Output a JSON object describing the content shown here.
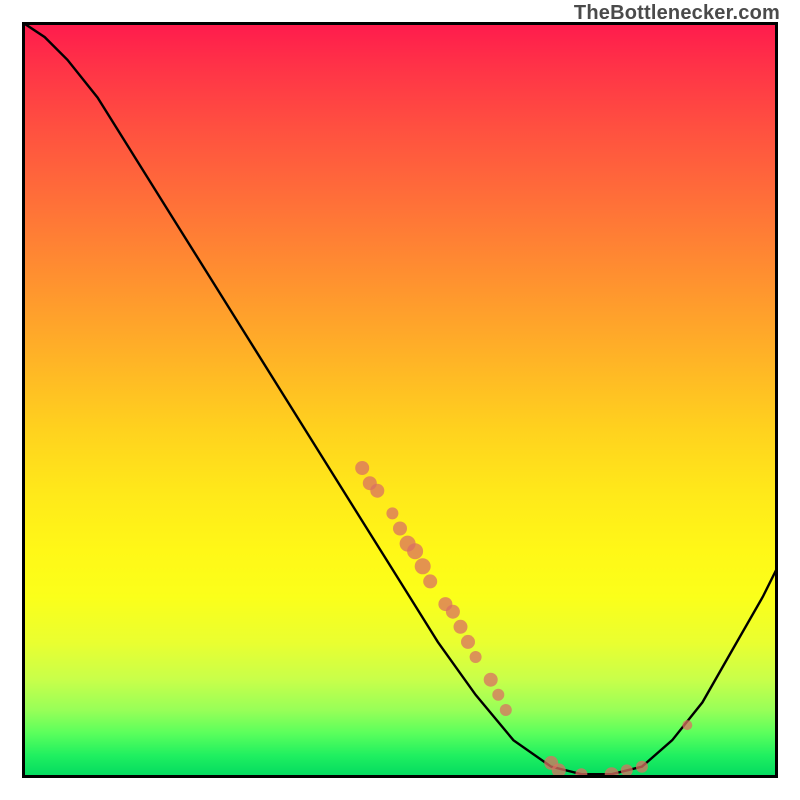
{
  "watermark": "TheBottlenecker.com",
  "colors": {
    "curve": "#000000",
    "dot": "#d97062",
    "border": "#000000"
  },
  "chart_data": {
    "type": "line",
    "title": "",
    "xlabel": "",
    "ylabel": "",
    "xlim": [
      0,
      100
    ],
    "ylim": [
      0,
      100
    ],
    "grid": false,
    "legend": false,
    "curve": [
      {
        "x": 0,
        "y": 100
      },
      {
        "x": 3,
        "y": 98
      },
      {
        "x": 6,
        "y": 95
      },
      {
        "x": 10,
        "y": 90
      },
      {
        "x": 15,
        "y": 82
      },
      {
        "x": 20,
        "y": 74
      },
      {
        "x": 25,
        "y": 66
      },
      {
        "x": 30,
        "y": 58
      },
      {
        "x": 35,
        "y": 50
      },
      {
        "x": 40,
        "y": 42
      },
      {
        "x": 45,
        "y": 34
      },
      {
        "x": 50,
        "y": 26
      },
      {
        "x": 55,
        "y": 18
      },
      {
        "x": 60,
        "y": 11
      },
      {
        "x": 65,
        "y": 5
      },
      {
        "x": 70,
        "y": 1.5
      },
      {
        "x": 74,
        "y": 0.5
      },
      {
        "x": 78,
        "y": 0.5
      },
      {
        "x": 82,
        "y": 1.5
      },
      {
        "x": 86,
        "y": 5
      },
      {
        "x": 90,
        "y": 10
      },
      {
        "x": 94,
        "y": 17
      },
      {
        "x": 98,
        "y": 24
      },
      {
        "x": 100,
        "y": 28
      }
    ],
    "points": [
      {
        "x": 45,
        "y": 41,
        "r": 7
      },
      {
        "x": 46,
        "y": 39,
        "r": 7
      },
      {
        "x": 47,
        "y": 38,
        "r": 7
      },
      {
        "x": 49,
        "y": 35,
        "r": 6
      },
      {
        "x": 50,
        "y": 33,
        "r": 7
      },
      {
        "x": 51,
        "y": 31,
        "r": 8
      },
      {
        "x": 52,
        "y": 30,
        "r": 8
      },
      {
        "x": 53,
        "y": 28,
        "r": 8
      },
      {
        "x": 54,
        "y": 26,
        "r": 7
      },
      {
        "x": 56,
        "y": 23,
        "r": 7
      },
      {
        "x": 57,
        "y": 22,
        "r": 7
      },
      {
        "x": 58,
        "y": 20,
        "r": 7
      },
      {
        "x": 59,
        "y": 18,
        "r": 7
      },
      {
        "x": 60,
        "y": 16,
        "r": 6
      },
      {
        "x": 62,
        "y": 13,
        "r": 7
      },
      {
        "x": 63,
        "y": 11,
        "r": 6
      },
      {
        "x": 64,
        "y": 9,
        "r": 6
      },
      {
        "x": 70,
        "y": 2,
        "r": 7
      },
      {
        "x": 71,
        "y": 1,
        "r": 7
      },
      {
        "x": 74,
        "y": 0.5,
        "r": 6
      },
      {
        "x": 78,
        "y": 0.5,
        "r": 7
      },
      {
        "x": 80,
        "y": 1,
        "r": 6
      },
      {
        "x": 82,
        "y": 1.5,
        "r": 6
      },
      {
        "x": 88,
        "y": 7,
        "r": 5
      }
    ]
  }
}
